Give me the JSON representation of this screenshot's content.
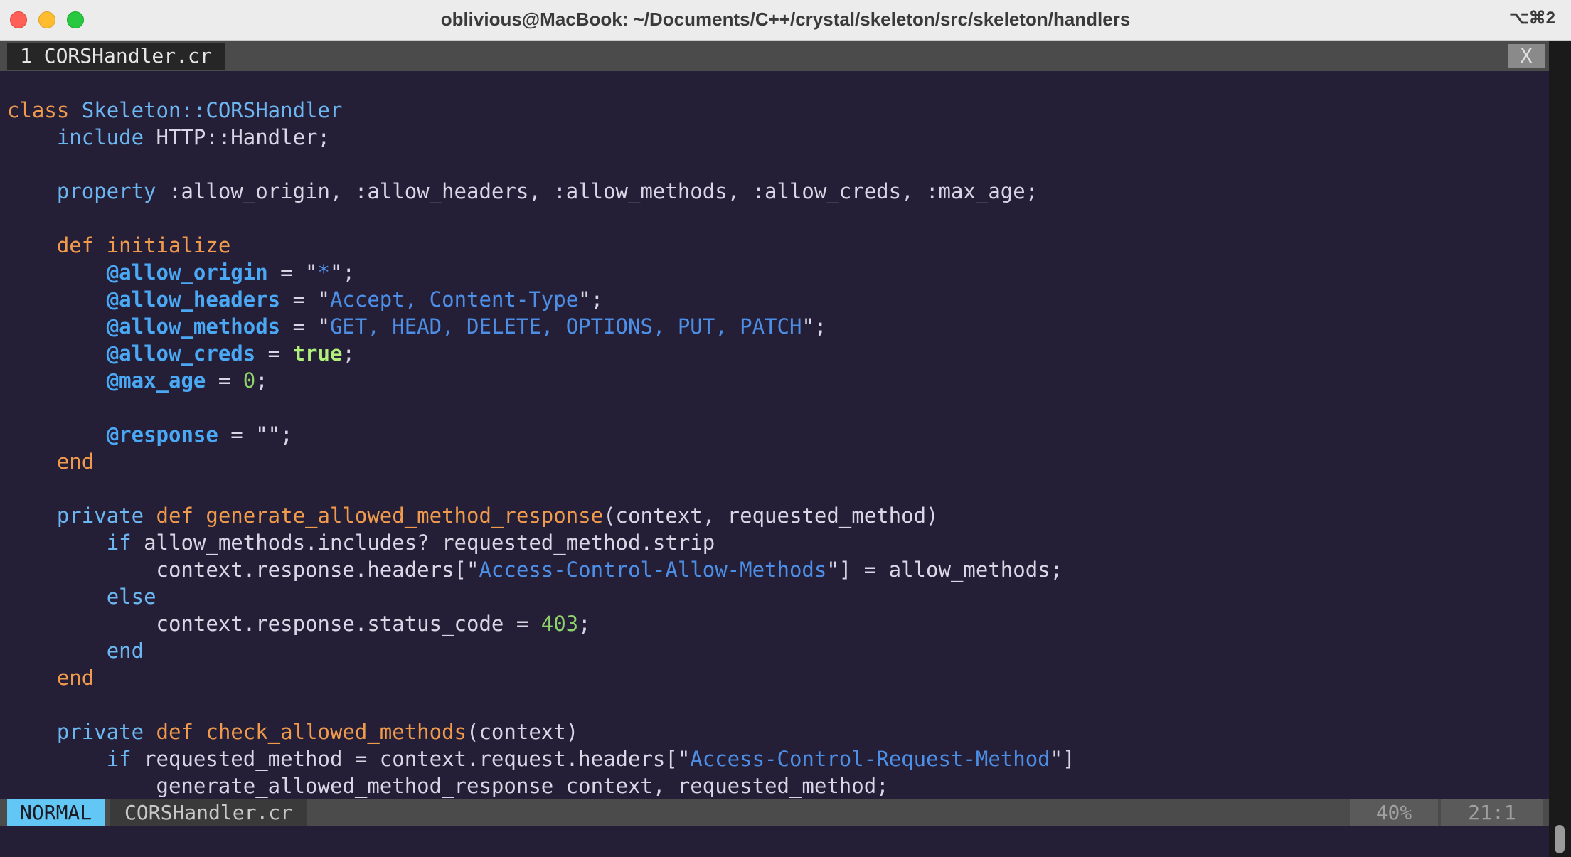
{
  "window": {
    "title": "oblivious@MacBook: ~/Documents/C++/crystal/skeleton/src/skeleton/handlers",
    "shortcut": "⌥⌘2",
    "buttons": [
      "close",
      "minimize",
      "zoom"
    ]
  },
  "tabline": {
    "tab_label": "1 CORSHandler.cr",
    "close_label": "X"
  },
  "code": {
    "l1": {
      "a": "class",
      "b": " Skeleton::CORSHandler"
    },
    "l2": {
      "a": "    ",
      "b": "include",
      "c": " HTTP::Handler;"
    },
    "l4": {
      "a": "    ",
      "b": "property",
      "c": " :allow_origin, :allow_headers, :allow_methods, :allow_creds, :max_age;"
    },
    "l6": {
      "a": "    ",
      "b": "def",
      "c": " initialize"
    },
    "l7": {
      "a": "        ",
      "b": "@allow_origin",
      "c": " = \"",
      "d": "*",
      "e": "\";"
    },
    "l8": {
      "a": "        ",
      "b": "@allow_headers",
      "c": " = \"",
      "d": "Accept, Content-Type",
      "e": "\";"
    },
    "l9": {
      "a": "        ",
      "b": "@allow_methods",
      "c": " = \"",
      "d": "GET, HEAD, DELETE, OPTIONS, PUT, PATCH",
      "e": "\";"
    },
    "l10": {
      "a": "        ",
      "b": "@allow_creds",
      "c": " = ",
      "d": "true",
      "e": ";"
    },
    "l11": {
      "a": "        ",
      "b": "@max_age",
      "c": " = ",
      "d": "0",
      "e": ";"
    },
    "l13": {
      "a": "        ",
      "b": "@response",
      "c": " = \"\";"
    },
    "l14": {
      "a": "    ",
      "b": "end"
    },
    "l16": {
      "a": "    ",
      "b": "private",
      "c": " def",
      "d": " generate_allowed_method_response",
      "e": "(context, requested_method)"
    },
    "l17": {
      "a": "        ",
      "b": "if",
      "c": " allow_methods.includes? requested_method.strip"
    },
    "l18": {
      "a": "            context.response.headers[\"",
      "b": "Access-Control-Allow-Methods",
      "c": "\"] = allow_methods;"
    },
    "l19": {
      "a": "        ",
      "b": "else"
    },
    "l20": {
      "a": "            context.response.status_code = ",
      "b": "403",
      "c": ";"
    },
    "l21": {
      "a": "        ",
      "b": "end"
    },
    "l22": {
      "a": "    ",
      "b": "end"
    },
    "l24": {
      "a": "    ",
      "b": "private",
      "c": " def",
      "d": " check_allowed_methods",
      "e": "(context)"
    },
    "l25": {
      "a": "        ",
      "b": "if",
      "c": " requested_method = context.request.headers[\"",
      "d": "Access-Control-Request-Method",
      "e": "\"]"
    },
    "l26": {
      "a": "            generate_allowed_method_response context, requested_method;"
    }
  },
  "statusline": {
    "mode": "NORMAL",
    "filename": "CORSHandler.cr",
    "percent": "40%",
    "position": "21:1"
  },
  "colors": {
    "background": "#241f36",
    "keyword_orange": "#ef9a4c",
    "keyword_blue": "#6cb6f2",
    "instance_var": "#4aa8f5",
    "string": "#4d8ee6",
    "number": "#8ed36b",
    "mode_badge": "#63c7f5"
  }
}
